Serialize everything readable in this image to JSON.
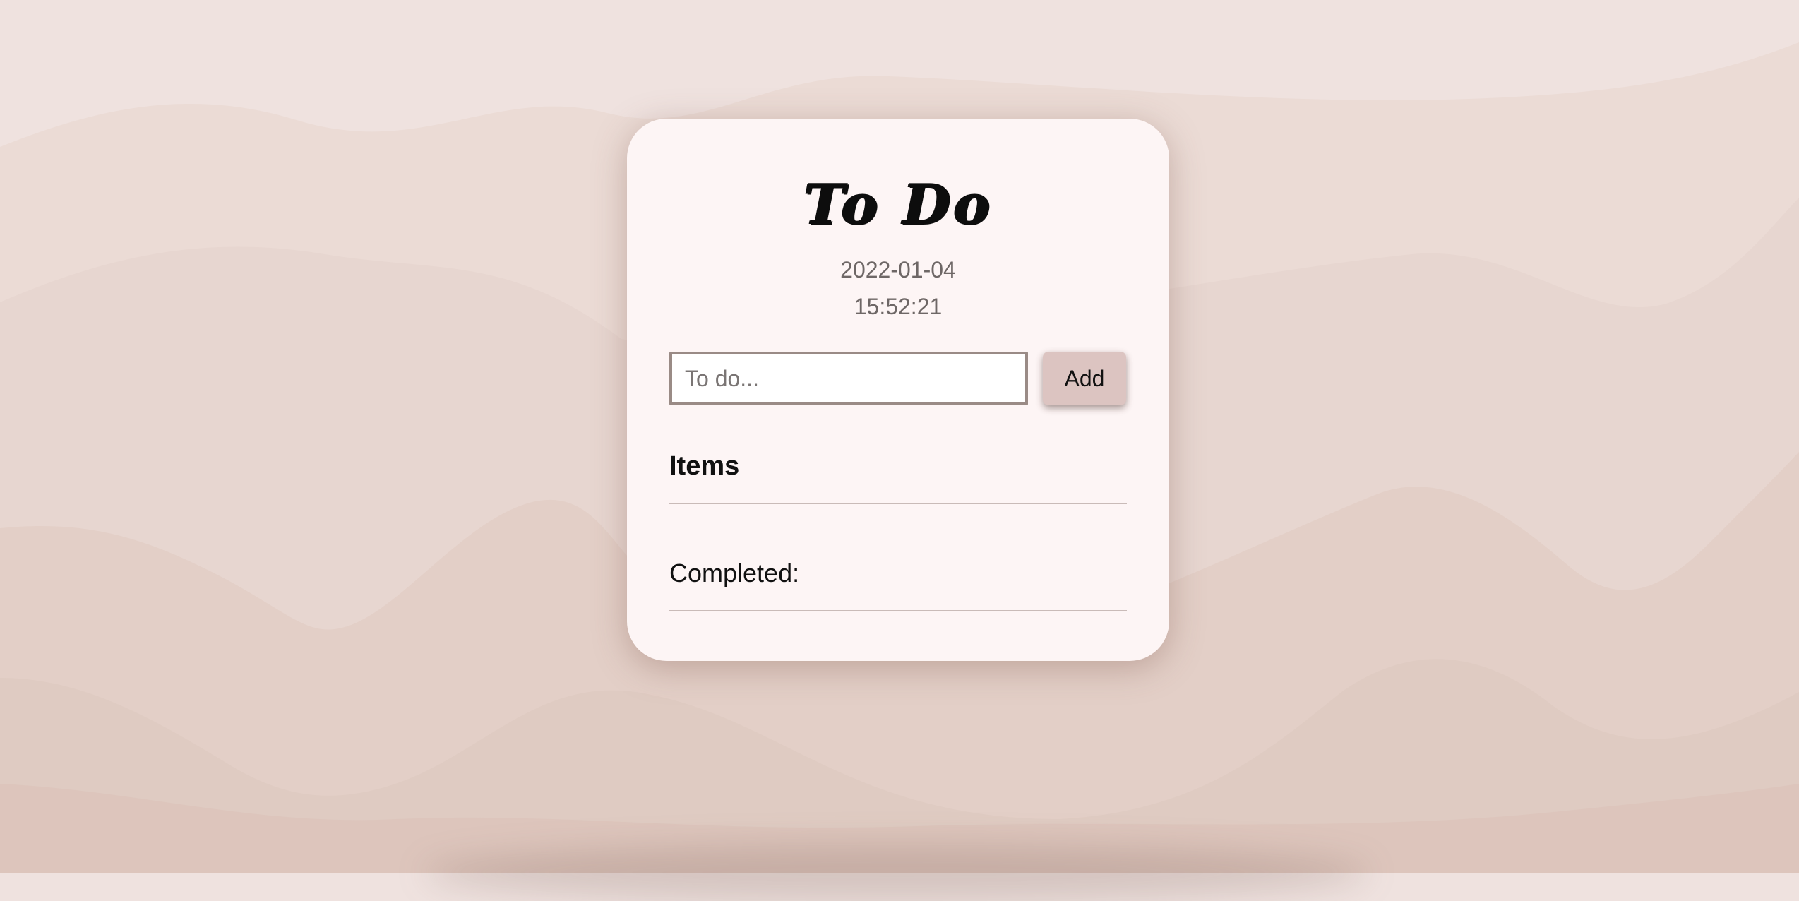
{
  "app": {
    "title": "To Do",
    "date": "2022-01-04",
    "time": "15:52:21"
  },
  "form": {
    "input_value": "",
    "input_placeholder": "To do...",
    "add_label": "Add"
  },
  "lists": {
    "items_heading": "Items",
    "items": [],
    "completed_label": "Completed:",
    "completed": []
  },
  "colors": {
    "card_background": "#fdf5f5",
    "add_button": "#dcc4c1",
    "input_border": "#9a8b86",
    "background_light": "#efe2df",
    "background_dark": "#dbbfb4"
  }
}
